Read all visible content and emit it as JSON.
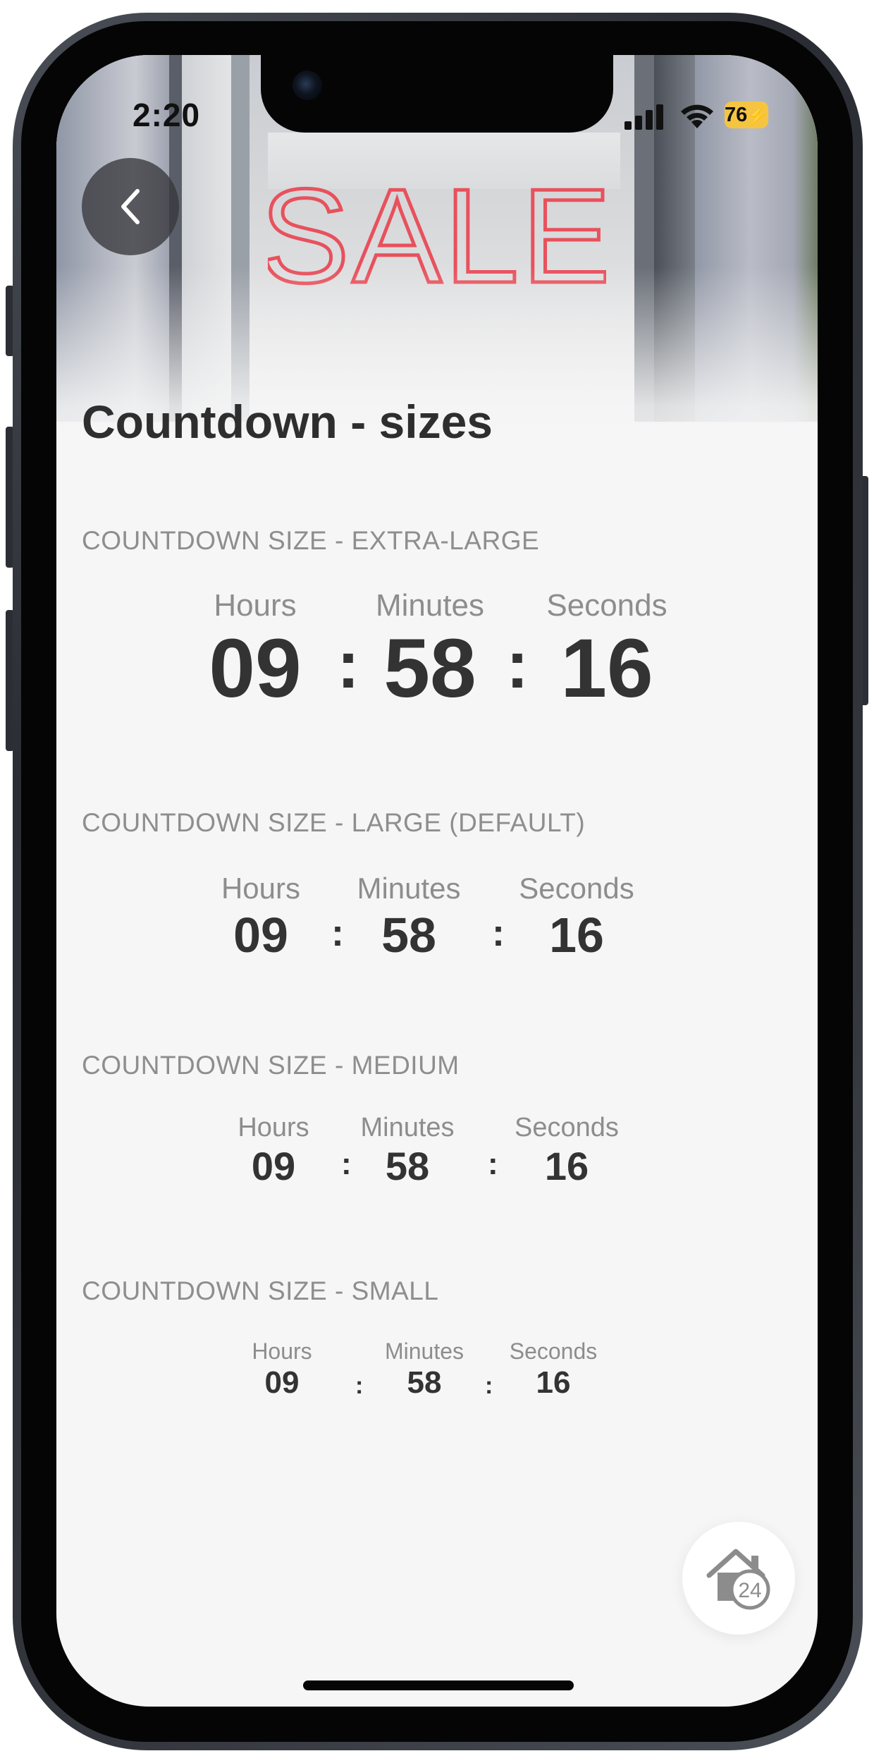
{
  "status_bar": {
    "time": "2:20",
    "battery": "76"
  },
  "hero": {
    "sign_text": "SALE",
    "sign_color": "#e8515c"
  },
  "back_button_icon": "chevron-left-icon",
  "page_title": "Countdown - sizes",
  "sections": [
    {
      "label": "COUNTDOWN SIZE - EXTRA-LARGE",
      "hours_caption": "Hours",
      "minutes_caption": "Minutes",
      "seconds_caption": "Seconds",
      "hours": "09",
      "minutes": "58",
      "seconds": "16",
      "separator": ":"
    },
    {
      "label": "COUNTDOWN SIZE - LARGE (DEFAULT)",
      "hours_caption": "Hours",
      "minutes_caption": "Minutes",
      "seconds_caption": "Seconds",
      "hours": "09",
      "minutes": "58",
      "seconds": "16",
      "separator": ":"
    },
    {
      "label": "COUNTDOWN SIZE - MEDIUM",
      "hours_caption": "Hours",
      "minutes_caption": "Minutes",
      "seconds_caption": "Seconds",
      "hours": "09",
      "minutes": "58",
      "seconds": "16",
      "separator": ":"
    },
    {
      "label": "COUNTDOWN SIZE - SMALL",
      "hours_caption": "Hours",
      "minutes_caption": "Minutes",
      "seconds_caption": "Seconds",
      "hours": "09",
      "minutes": "58",
      "seconds": "16",
      "separator": ":"
    }
  ],
  "fab": {
    "icon": "home-24-icon",
    "badge": "24"
  }
}
